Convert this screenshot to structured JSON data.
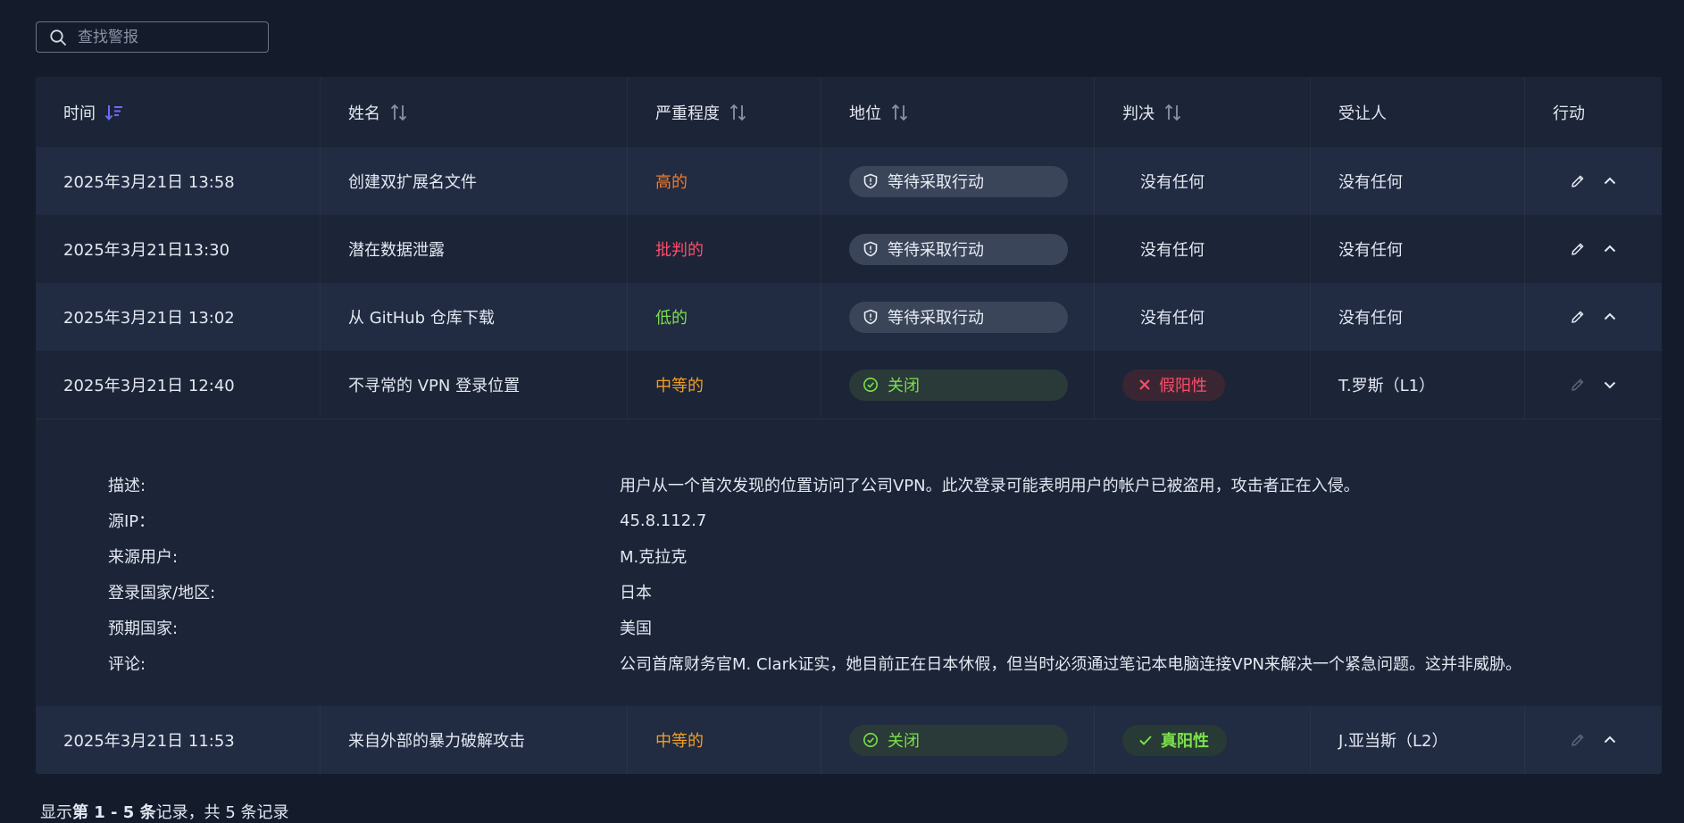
{
  "search": {
    "placeholder": "查找警报",
    "icon": "search-icon"
  },
  "table": {
    "headers": {
      "time": "时间",
      "name": "姓名",
      "severity": "严重程度",
      "status": "地位",
      "verdict": "判决",
      "assignee": "受让人",
      "action": "行动"
    },
    "rows": [
      {
        "time": "2025年3月21日 13:58",
        "name": "创建双扩展名文件",
        "severity": "高的",
        "severity_color": "#f07a2a",
        "status": "等待采取行动",
        "verdict": "没有任何",
        "assignee": "没有任何"
      },
      {
        "time": "2025年3月21日13:30",
        "name": "潜在数据泄露",
        "severity": "批判的",
        "severity_color": "#ff4d6a",
        "status": "等待采取行动",
        "verdict": "没有任何",
        "assignee": "没有任何"
      },
      {
        "time": "2025年3月21日 13:02",
        "name": "从 GitHub 仓库下载",
        "severity": "低的",
        "severity_color": "#7be04a",
        "status": "等待采取行动",
        "verdict": "没有任何",
        "assignee": "没有任何"
      },
      {
        "time": "2025年3月21日 12:40",
        "name": "不寻常的 VPN 登录位置",
        "severity": "中等的",
        "severity_color": "#f0a020",
        "status": "关闭",
        "verdict": "假阳性",
        "assignee": "T.罗斯（L1）"
      },
      {
        "time": "2025年3月21日 11:53",
        "name": "来自外部的暴力破解攻击",
        "severity": "中等的",
        "severity_color": "#f0a020",
        "status": "关闭",
        "verdict": "真阳性",
        "assignee": "J.亚当斯（L2）"
      }
    ],
    "details": [
      {
        "label": "描述:",
        "value": "用户从一个首次发现的位置访问了公司VPN。此次登录可能表明用户的帐户已被盗用，攻击者正在入侵。"
      },
      {
        "label": "源IP：",
        "value": "45.8.112.7"
      },
      {
        "label": "来源用户:",
        "value": "M.克拉克"
      },
      {
        "label": "登录国家/地区:",
        "value": "日本"
      },
      {
        "label": "预期国家:",
        "value": "美国"
      },
      {
        "label": "评论:",
        "value": "公司首席财务官M. Clark证实，她目前正在日本休假，但当时必须通过笔记本电脑连接VPN来解决一个紧急问题。这并非威胁。"
      }
    ]
  },
  "footer": {
    "prefix": "显示",
    "range": "第 1 - 5 条",
    "suffix": "记录，共 5 条记录"
  },
  "colors": {
    "accent": "#6a6cf6",
    "closed": "#7be04a",
    "false_positive": "#ff4d6a"
  }
}
